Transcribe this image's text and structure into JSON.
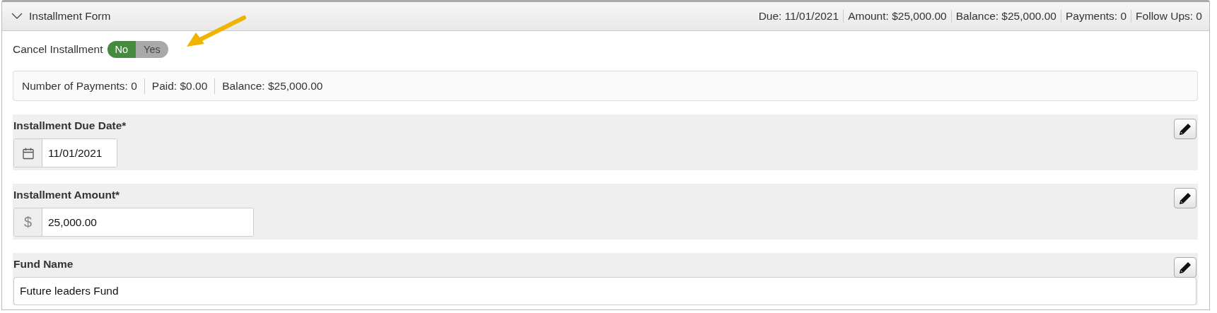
{
  "panel": {
    "title": "Installment Form",
    "expanded": true,
    "summary": [
      "Due: 11/01/2021",
      "Amount: $25,000.00",
      "Balance: $25,000.00",
      "Payments: 0",
      "Follow Ups: 0"
    ]
  },
  "cancel_installment": {
    "label": "Cancel Installment",
    "options": [
      {
        "label": "No",
        "selected": true
      },
      {
        "label": "Yes",
        "selected": false
      }
    ]
  },
  "totals": [
    "Number of Payments: 0",
    "Paid: $0.00",
    "Balance: $25,000.00"
  ],
  "fields": [
    {
      "kind": "date",
      "label": "Installment Due Date*",
      "value": "11/01/2021"
    },
    {
      "kind": "currency",
      "label": "Installment Amount*",
      "prefix": "$",
      "value": "25,000.00"
    },
    {
      "kind": "text",
      "label": "Fund Name",
      "value": "Future leaders Fund"
    }
  ],
  "annotations": [
    {
      "kind": "arrow"
    }
  ]
}
